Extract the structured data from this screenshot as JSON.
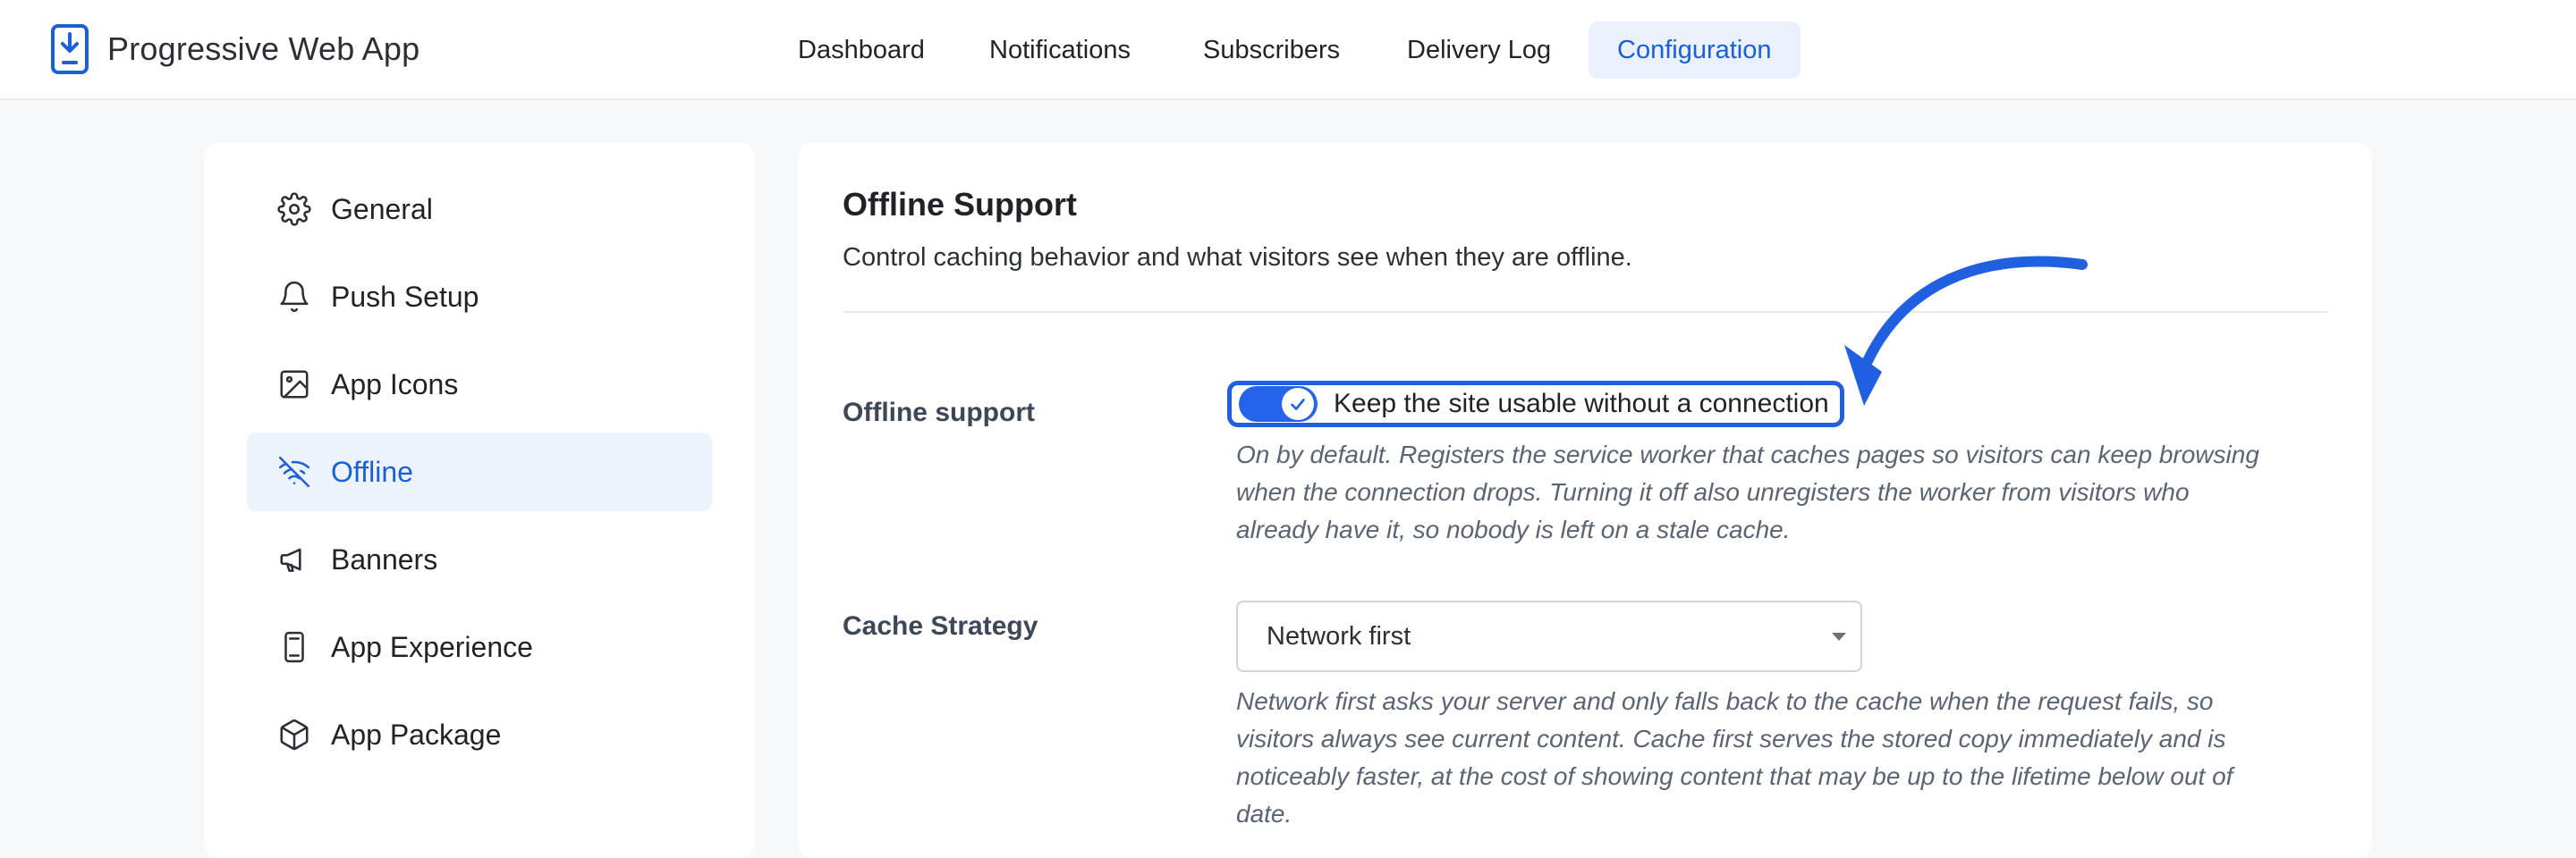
{
  "app": {
    "title": "Progressive Web App",
    "brand_icon": "phone-download-icon"
  },
  "nav": {
    "items": [
      {
        "label": "Dashboard",
        "active": false
      },
      {
        "label": "Notifications",
        "active": false
      },
      {
        "label": "Subscribers",
        "active": false
      },
      {
        "label": "Delivery Log",
        "active": false
      },
      {
        "label": "Configuration",
        "active": true
      }
    ]
  },
  "sidebar": {
    "items": [
      {
        "label": "General",
        "icon": "gear-icon",
        "active": false
      },
      {
        "label": "Push Setup",
        "icon": "bell-icon",
        "active": false
      },
      {
        "label": "App Icons",
        "icon": "image-icon",
        "active": false
      },
      {
        "label": "Offline",
        "icon": "wifi-off-icon",
        "active": true
      },
      {
        "label": "Banners",
        "icon": "megaphone-icon",
        "active": false
      },
      {
        "label": "App Experience",
        "icon": "mobile-device-icon",
        "active": false
      },
      {
        "label": "App Package",
        "icon": "package-box-icon",
        "active": false
      }
    ]
  },
  "panel": {
    "title": "Offline Support",
    "description": "Control caching behavior and what visitors see when they are offline."
  },
  "offline_support": {
    "label": "Offline support",
    "toggle_label": "Keep the site usable without a connection",
    "enabled": true,
    "help_lines": [
      "On by default. Registers the service worker that caches pages so visitors can keep browsing",
      "when the connection drops. Turning it off also unregisters the worker from visitors who",
      "already have it, so nobody is left on a stale cache."
    ]
  },
  "cache_strategy": {
    "label": "Cache Strategy",
    "selected": "Network first",
    "help_lines": [
      "Network first asks your server and only falls back to the cache when the request fails, so",
      "visitors always see current content. Cache first serves the stored copy immediately and is",
      "noticeably faster, at the cost of showing content that may be up to the lifetime below out of",
      "date."
    ]
  },
  "colors": {
    "accent": "#1a5fd6",
    "toggle_on": "#2563eb",
    "annotation": "#1f5fe0",
    "active_bg": "#edf3fd"
  }
}
